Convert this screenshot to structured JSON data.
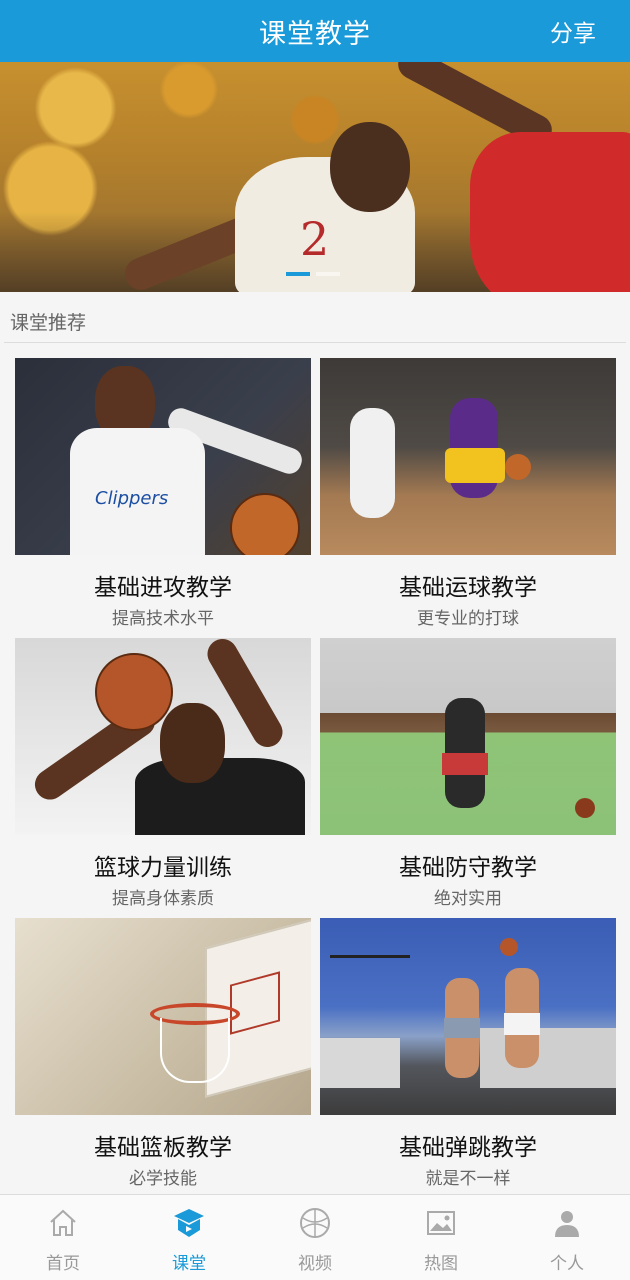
{
  "header": {
    "title": "课堂教学",
    "share_label": "分享"
  },
  "banner": {
    "slide_count": 2,
    "active_index": 0
  },
  "section": {
    "title": "课堂推荐"
  },
  "courses": [
    {
      "title": "基础进攻教学",
      "subtitle": "提高技术水平"
    },
    {
      "title": "基础运球教学",
      "subtitle": "更专业的打球"
    },
    {
      "title": "篮球力量训练",
      "subtitle": "提高身体素质"
    },
    {
      "title": "基础防守教学",
      "subtitle": "绝对实用"
    },
    {
      "title": "基础篮板教学",
      "subtitle": "必学技能"
    },
    {
      "title": "基础弹跳教学",
      "subtitle": "就是不一样"
    }
  ],
  "tabbar": {
    "items": [
      {
        "label": "首页",
        "icon": "home-icon"
      },
      {
        "label": "课堂",
        "icon": "classroom-icon",
        "active": true
      },
      {
        "label": "视频",
        "icon": "video-icon"
      },
      {
        "label": "热图",
        "icon": "image-icon"
      },
      {
        "label": "个人",
        "icon": "person-icon"
      }
    ]
  },
  "colors": {
    "primary": "#1a9ad8",
    "inactive": "#999999",
    "background": "#f5f5f5"
  }
}
